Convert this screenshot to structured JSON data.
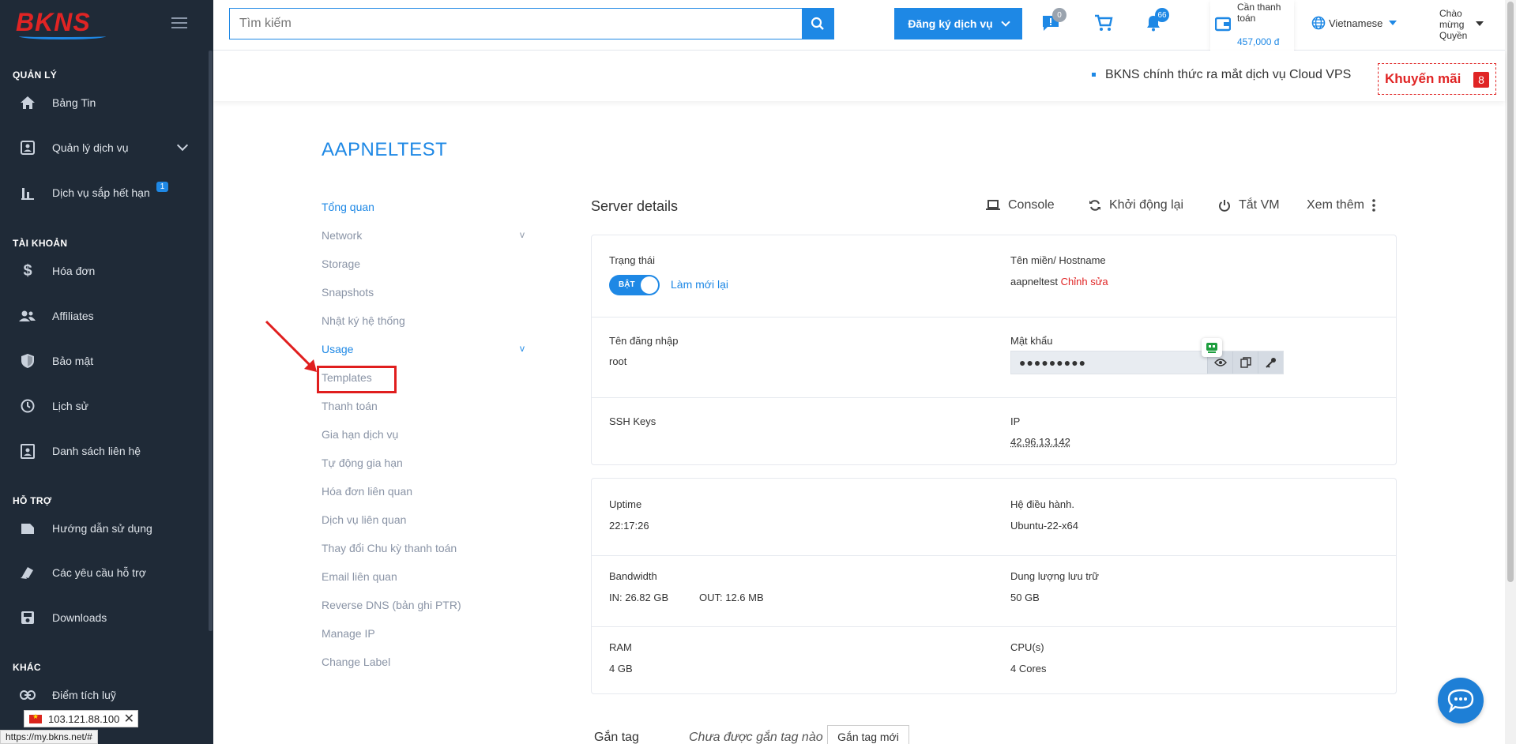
{
  "brand": {
    "logo_text": "BKNS"
  },
  "sidebar": {
    "sections": [
      {
        "label": "QUẢN LÝ"
      },
      {
        "label": "TÀI KHOẢN"
      },
      {
        "label": "HỖ TRỢ"
      },
      {
        "label": "KHÁC"
      }
    ],
    "items": [
      {
        "label": "Bảng Tin",
        "icon": "home-icon"
      },
      {
        "label": "Quản lý dịch vụ",
        "icon": "user-box-icon"
      },
      {
        "label": "Dịch vụ sắp hết hạn",
        "icon": "bar-chart-icon",
        "badge": "1"
      },
      {
        "label": "Hóa đơn",
        "icon": "dollar-icon"
      },
      {
        "label": "Affiliates",
        "icon": "users-icon"
      },
      {
        "label": "Bảo mật",
        "icon": "shield-icon"
      },
      {
        "label": "Lịch sử",
        "icon": "history-icon"
      },
      {
        "label": "Danh sách liên hệ",
        "icon": "contact-icon"
      },
      {
        "label": "Hướng dẫn sử dụng",
        "icon": "guide-icon"
      },
      {
        "label": "Các yêu cầu hỗ trợ",
        "icon": "ticket-icon"
      },
      {
        "label": "Downloads",
        "icon": "save-icon"
      },
      {
        "label": "Điểm tích luỹ",
        "icon": "link-icon"
      }
    ],
    "ip_chip": "103.121.88.100",
    "status_url": "https://my.bkns.net/#"
  },
  "header": {
    "search_placeholder": "Tìm kiếm",
    "register_label": "Đăng ký dịch vụ",
    "chat_badge": "0",
    "bell_badge": "66",
    "wallet_label": "Cần thanh toán",
    "wallet_value": "457,000 đ",
    "language": "Vietnamese",
    "greeting": "Chào mừng Quyền"
  },
  "ticker": {
    "news": "BKNS chính thức ra mắt dịch vụ Cloud VPS",
    "promo_label": "Khuyến mãi",
    "promo_count": "8"
  },
  "page": {
    "title": "AAPNELTEST",
    "nav": [
      {
        "label": "Tổng quan",
        "active": true
      },
      {
        "label": "Network",
        "chevron": "v"
      },
      {
        "label": "Storage"
      },
      {
        "label": "Snapshots"
      },
      {
        "label": "Nhật ký hệ thống"
      },
      {
        "label": "Usage",
        "active": true,
        "chevron": "v"
      },
      {
        "label": "Templates"
      },
      {
        "label": "Thanh toán"
      },
      {
        "label": "Gia hạn dịch vụ"
      },
      {
        "label": "Tự động gia hạn"
      },
      {
        "label": "Hóa đơn liên quan"
      },
      {
        "label": "Dịch vụ liên quan"
      },
      {
        "label": "Thay đổi Chu kỳ thanh toán"
      },
      {
        "label": "Email liên quan"
      },
      {
        "label": "Reverse DNS (bản ghi PTR)"
      },
      {
        "label": "Manage IP"
      },
      {
        "label": "Change Label"
      }
    ]
  },
  "server": {
    "title": "Server details",
    "actions": {
      "console": "Console",
      "restart": "Khởi động lại",
      "shutdown": "Tắt VM",
      "more": "Xem thêm"
    },
    "status_label": "Trạng thái",
    "status_toggle": "BẬT",
    "refresh": "Làm mới lại",
    "hostname_label": "Tên miền/ Hostname",
    "hostname": "aapneltest",
    "edit": "Chỉnh sửa",
    "username_label": "Tên đăng nhập",
    "username": "root",
    "password_label": "Mật khẩu",
    "password_mask": "●●●●●●●●●",
    "ssh_label": "SSH Keys",
    "ip_label": "IP",
    "ip": "42.96.13.142",
    "uptime_label": "Uptime",
    "uptime": "22:17:26",
    "os_label": "Hệ điều hành.",
    "os": "Ubuntu-22-x64",
    "bandwidth_label": "Bandwidth",
    "bw_in": "IN: 26.82 GB",
    "bw_out": "OUT: 12.6 MB",
    "storage_label": "Dung lượng lưu trữ",
    "storage": "50 GB",
    "ram_label": "RAM",
    "ram": "4 GB",
    "cpu_label": "CPU(s)",
    "cpu": "4 Cores"
  },
  "tags": {
    "label": "Gắn tag",
    "none": "Chưa được gắn tag nào",
    "button": "Gắn tag mới"
  }
}
